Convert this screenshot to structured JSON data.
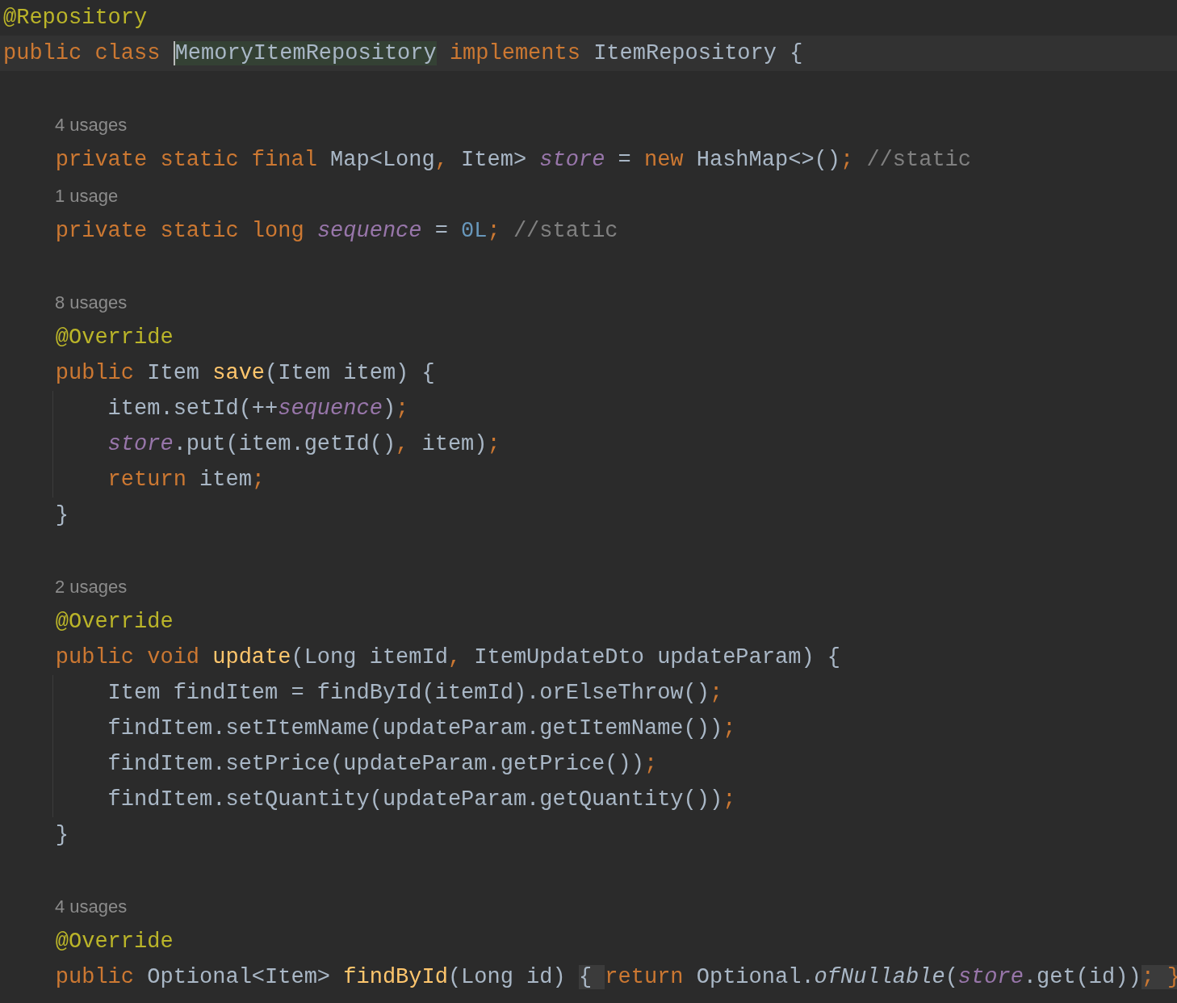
{
  "lines": [
    {
      "kind": "code",
      "tokens": [
        {
          "kind": "annotation",
          "text": "@Repository"
        }
      ]
    },
    {
      "kind": "code",
      "current": true,
      "tokens": [
        {
          "kind": "keyword",
          "text": "public class "
        },
        {
          "kind": "declaration",
          "text": "MemoryItemRepository"
        },
        {
          "kind": "keyword",
          "text": " implements "
        },
        {
          "kind": "plain",
          "text": "ItemRepository {"
        }
      ]
    },
    {
      "kind": "blank"
    },
    {
      "kind": "usages",
      "text": "4 usages"
    },
    {
      "kind": "code",
      "tokens": [
        {
          "kind": "keyword",
          "text": "    private static final "
        },
        {
          "kind": "plain",
          "text": "Map<Long"
        },
        {
          "kind": "keyword",
          "text": ", "
        },
        {
          "kind": "plain",
          "text": "Item> "
        },
        {
          "kind": "field",
          "text": "store"
        },
        {
          "kind": "plain",
          "text": " = "
        },
        {
          "kind": "keyword",
          "text": "new "
        },
        {
          "kind": "plain",
          "text": "HashMap<>()"
        },
        {
          "kind": "keyword",
          "text": "; "
        },
        {
          "kind": "comment",
          "text": "//static"
        }
      ]
    },
    {
      "kind": "usages",
      "text": "1 usage"
    },
    {
      "kind": "code",
      "tokens": [
        {
          "kind": "keyword",
          "text": "    private static long "
        },
        {
          "kind": "field",
          "text": "sequence"
        },
        {
          "kind": "plain",
          "text": " = "
        },
        {
          "kind": "number",
          "text": "0L"
        },
        {
          "kind": "keyword",
          "text": "; "
        },
        {
          "kind": "comment",
          "text": "//static"
        }
      ]
    },
    {
      "kind": "blank"
    },
    {
      "kind": "usages",
      "text": "8 usages"
    },
    {
      "kind": "code",
      "tokens": [
        {
          "kind": "annotation",
          "text": "    @Override"
        }
      ]
    },
    {
      "kind": "code",
      "tokens": [
        {
          "kind": "keyword",
          "text": "    public "
        },
        {
          "kind": "plain",
          "text": "Item "
        },
        {
          "kind": "method",
          "text": "save"
        },
        {
          "kind": "plain",
          "text": "(Item item) {"
        }
      ]
    },
    {
      "kind": "code",
      "guide": true,
      "tokens": [
        {
          "kind": "plain",
          "text": "        item.setId(++"
        },
        {
          "kind": "field",
          "text": "sequence"
        },
        {
          "kind": "plain",
          "text": ")"
        },
        {
          "kind": "keyword",
          "text": ";"
        }
      ]
    },
    {
      "kind": "code",
      "guide": true,
      "tokens": [
        {
          "kind": "field",
          "text": "        store"
        },
        {
          "kind": "plain",
          "text": ".put(item.getId()"
        },
        {
          "kind": "keyword",
          "text": ", "
        },
        {
          "kind": "plain",
          "text": "item)"
        },
        {
          "kind": "keyword",
          "text": ";"
        }
      ]
    },
    {
      "kind": "code",
      "guide": true,
      "tokens": [
        {
          "kind": "keyword",
          "text": "        return "
        },
        {
          "kind": "plain",
          "text": "item"
        },
        {
          "kind": "keyword",
          "text": ";"
        }
      ]
    },
    {
      "kind": "code",
      "tokens": [
        {
          "kind": "plain",
          "text": "    }"
        }
      ]
    },
    {
      "kind": "blank"
    },
    {
      "kind": "usages",
      "text": "2 usages"
    },
    {
      "kind": "code",
      "tokens": [
        {
          "kind": "annotation",
          "text": "    @Override"
        }
      ]
    },
    {
      "kind": "code",
      "tokens": [
        {
          "kind": "keyword",
          "text": "    public void "
        },
        {
          "kind": "method",
          "text": "update"
        },
        {
          "kind": "plain",
          "text": "(Long itemId"
        },
        {
          "kind": "keyword",
          "text": ", "
        },
        {
          "kind": "plain",
          "text": "ItemUpdateDto updateParam) {"
        }
      ]
    },
    {
      "kind": "code",
      "guide": true,
      "tokens": [
        {
          "kind": "plain",
          "text": "        Item findItem = findById(itemId).orElseThrow()"
        },
        {
          "kind": "keyword",
          "text": ";"
        }
      ]
    },
    {
      "kind": "code",
      "guide": true,
      "tokens": [
        {
          "kind": "plain",
          "text": "        findItem.setItemName(updateParam.getItemName())"
        },
        {
          "kind": "keyword",
          "text": ";"
        }
      ]
    },
    {
      "kind": "code",
      "guide": true,
      "tokens": [
        {
          "kind": "plain",
          "text": "        findItem.setPrice(updateParam.getPrice())"
        },
        {
          "kind": "keyword",
          "text": ";"
        }
      ]
    },
    {
      "kind": "code",
      "guide": true,
      "tokens": [
        {
          "kind": "plain",
          "text": "        findItem.setQuantity(updateParam.getQuantity())"
        },
        {
          "kind": "keyword",
          "text": ";"
        }
      ]
    },
    {
      "kind": "code",
      "tokens": [
        {
          "kind": "plain",
          "text": "    }"
        }
      ]
    },
    {
      "kind": "blank"
    },
    {
      "kind": "usages",
      "text": "4 usages"
    },
    {
      "kind": "code",
      "tokens": [
        {
          "kind": "annotation",
          "text": "    @Override"
        }
      ]
    },
    {
      "kind": "code",
      "tokens": [
        {
          "kind": "keyword",
          "text": "    public "
        },
        {
          "kind": "plain",
          "text": "Optional<Item> "
        },
        {
          "kind": "method",
          "text": "findById"
        },
        {
          "kind": "plain",
          "text": "(Long id) "
        },
        {
          "kind": "fold",
          "text": "{ "
        },
        {
          "kind": "keyword",
          "text": "return "
        },
        {
          "kind": "plain",
          "text": "Optional."
        },
        {
          "kind": "static_method",
          "text": "ofNullable"
        },
        {
          "kind": "plain",
          "text": "("
        },
        {
          "kind": "field",
          "text": "store"
        },
        {
          "kind": "plain",
          "text": ".get(id))"
        },
        {
          "kind": "fold_semi",
          "text": "; }"
        }
      ]
    }
  ]
}
